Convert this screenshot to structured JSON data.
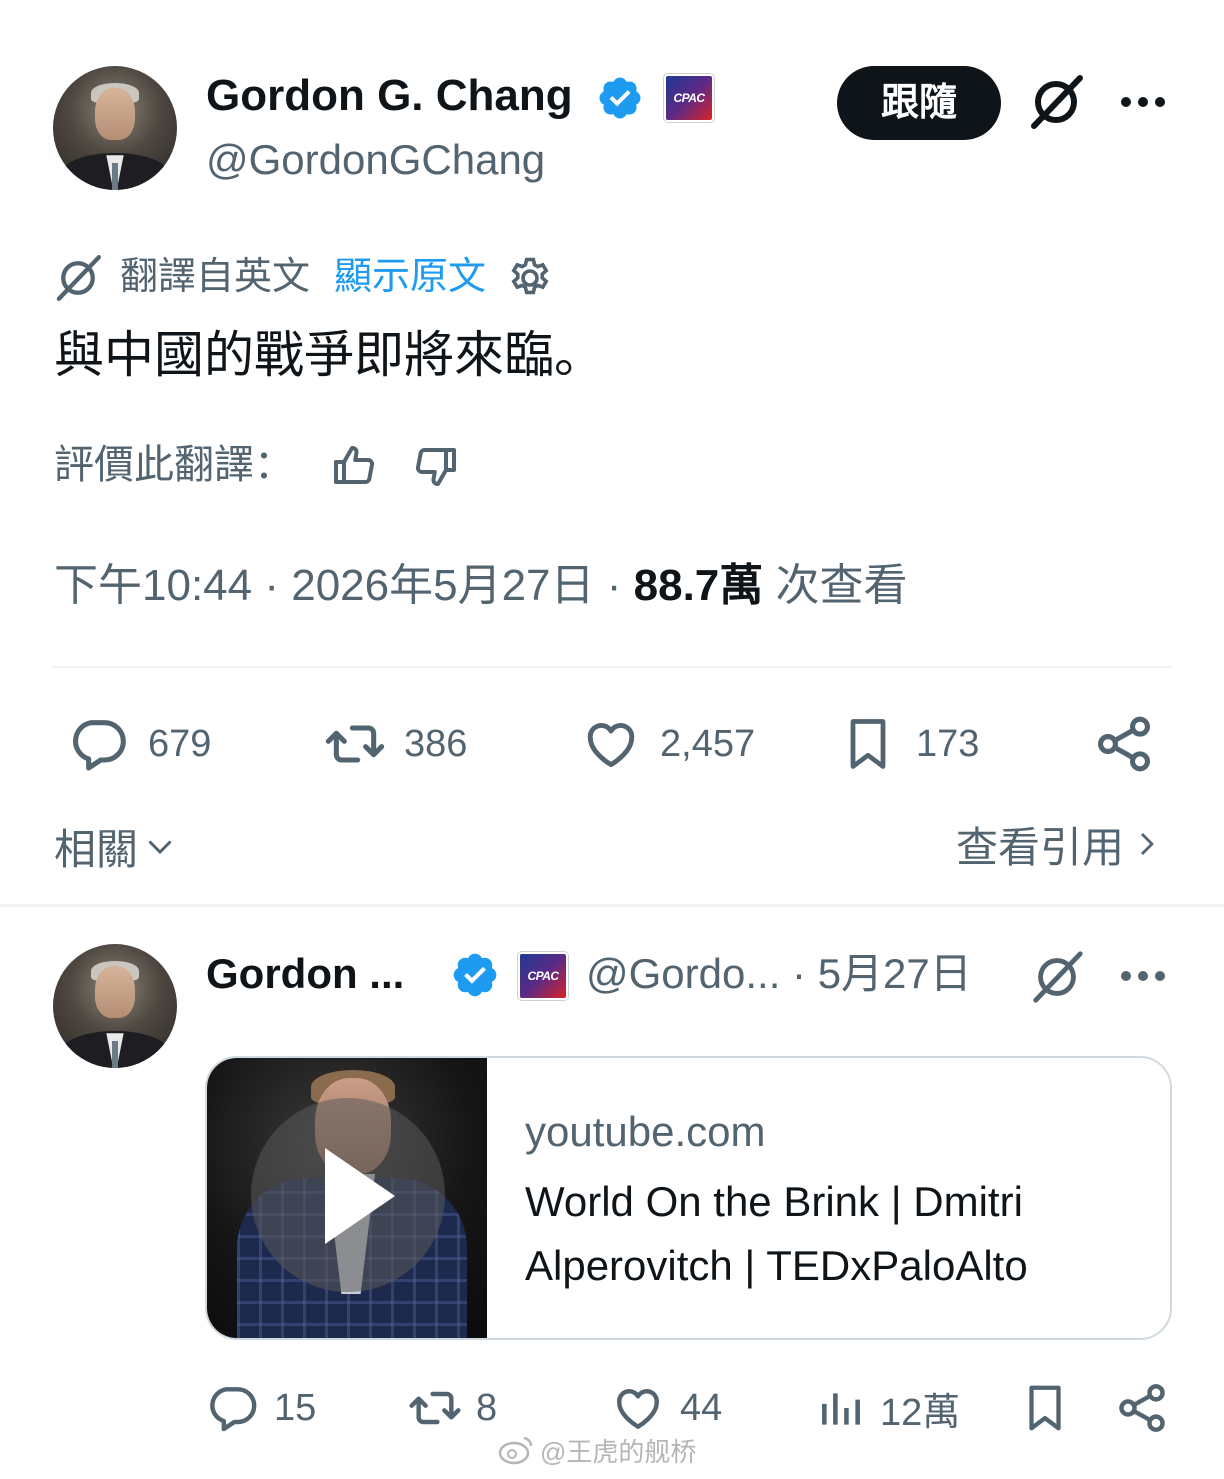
{
  "tweet": {
    "author_name": "Gordon G. Chang",
    "handle": "@GordonGChang",
    "affiliation_badge": "CPAC",
    "follow_label": "跟隨",
    "translation": {
      "label": "翻譯自英文",
      "show_original": "顯示原文"
    },
    "text": "與中國的戰爭即將來臨。",
    "rate_translation": "評價此翻譯：",
    "meta": {
      "time": "下午10:44",
      "sep1": " · ",
      "date": "2026年5月27日",
      "sep2": " · ",
      "views_count": "88.7萬",
      "views_label": " 次查看"
    },
    "stats": {
      "replies": "679",
      "retweets": "386",
      "likes": "2,457",
      "bookmarks": "173"
    },
    "related_label": "相關",
    "quotes_label": "查看引用"
  },
  "reply_tweet": {
    "author_name": "Gordon ...",
    "affiliation_badge": "CPAC",
    "handle": "@Gordo...",
    "date": " · 5月27日",
    "card": {
      "domain": "youtube.com",
      "title": "World On the Brink | Dmitri Alperovitch | TEDxPaloAlto"
    },
    "stats": {
      "replies": "15",
      "retweets": "8",
      "likes": "44",
      "views": "12萬"
    }
  },
  "watermark": "@王虎的舰桥",
  "colors": {
    "text": "#0f1419",
    "secondary": "#536471",
    "link": "#1d9bf0",
    "verified": "#1d9bf0",
    "divider": "#eff3f4"
  },
  "icons": [
    "verified-badge-icon",
    "grok-icon",
    "more-icon",
    "translate-icon",
    "settings-icon",
    "thumbs-up-icon",
    "thumbs-down-icon",
    "reply-icon",
    "retweet-icon",
    "like-icon",
    "bookmark-icon",
    "share-icon",
    "chevron-down-icon",
    "chevron-right-icon",
    "views-icon",
    "play-icon",
    "weibo-icon"
  ]
}
